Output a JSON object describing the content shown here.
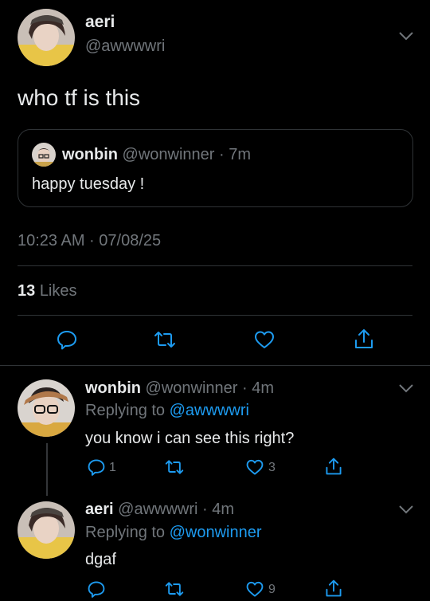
{
  "main_tweet": {
    "name": "aeri",
    "handle": "@awwwwri",
    "text": "who tf is this",
    "quote": {
      "name": "wonbin",
      "handle": "@wonwinner",
      "time": "· 7m",
      "text": "happy tuesday !"
    },
    "timestamp": "10:23 AM · 07/08/25",
    "likes_count": "13",
    "likes_label": "Likes"
  },
  "replies": [
    {
      "name": "wonbin",
      "handle": "@wonwinner",
      "time": "· 4m",
      "replying_label": "Replying to",
      "replying_to": "@awwwwri",
      "text": "you know i can see this right?",
      "reply_count": "1",
      "like_count": "3"
    },
    {
      "name": "aeri",
      "handle": "@awwwwri",
      "time": "· 4m",
      "replying_label": "Replying to",
      "replying_to": "@wonwinner",
      "text": "dgaf",
      "like_count": "9"
    }
  ],
  "colors": {
    "background": "#000000",
    "text": "#e7e9ea",
    "muted": "#71767b",
    "link": "#1d9bf0",
    "divider": "#2f3336"
  },
  "icons": [
    "chevron-down-icon",
    "reply-icon",
    "retweet-icon",
    "like-icon",
    "share-icon"
  ]
}
